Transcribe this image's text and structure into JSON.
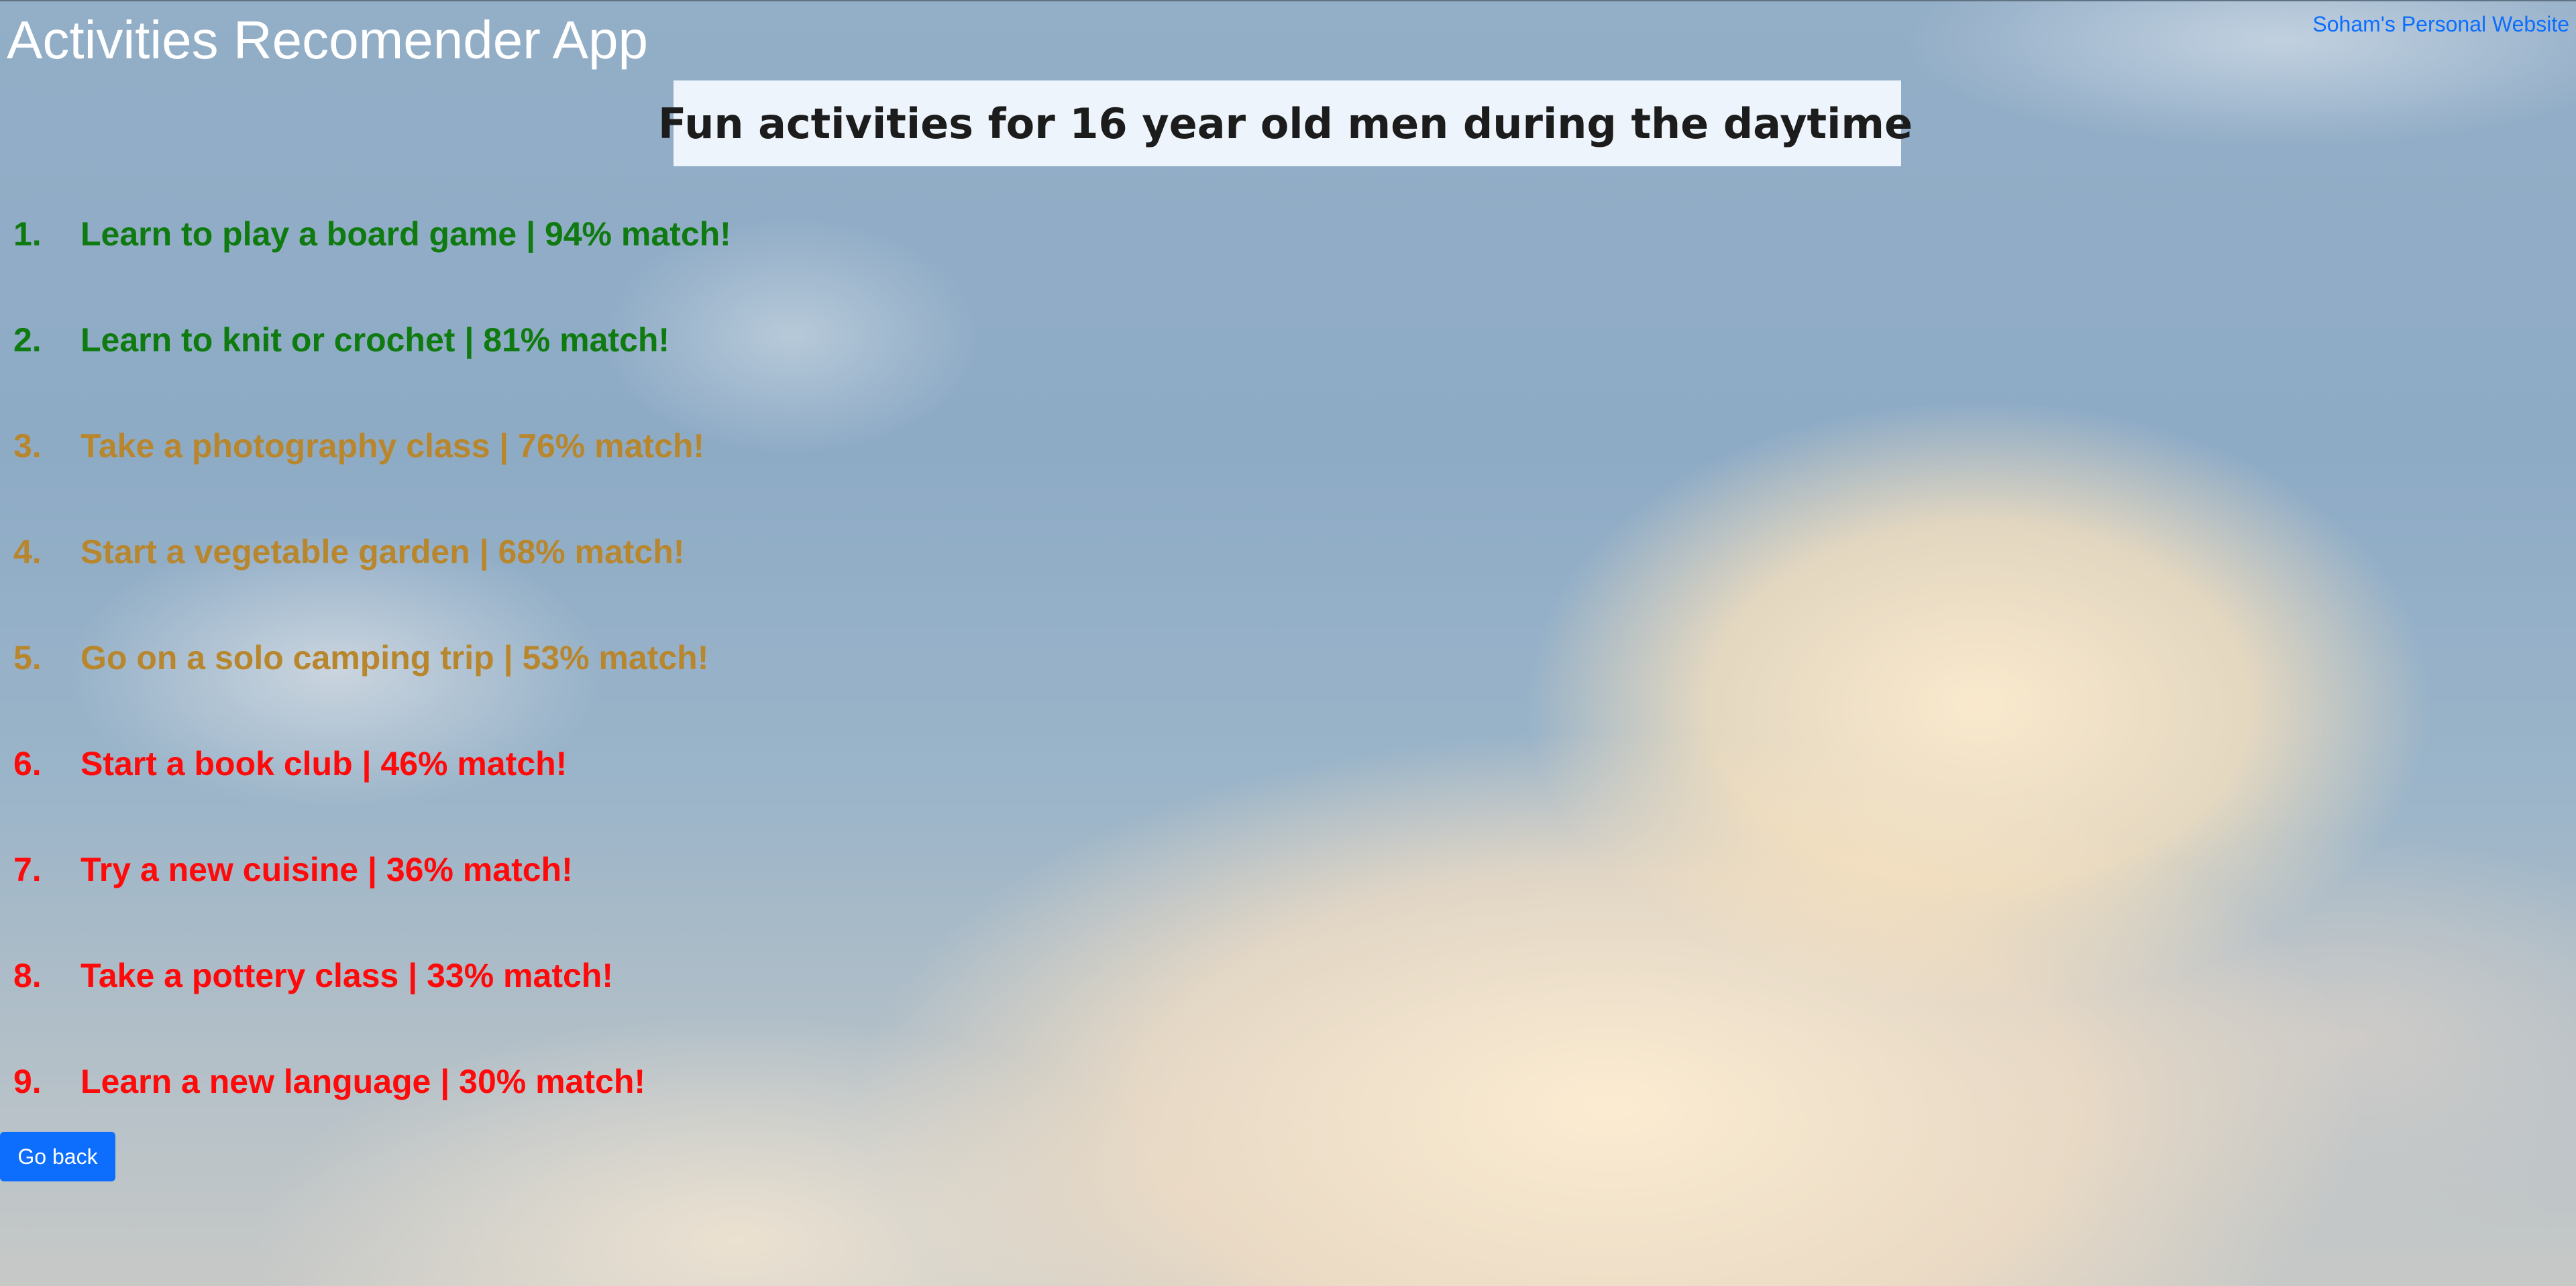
{
  "app": {
    "title": "Activities Recomender App",
    "personal_link": "Soham's Personal Website"
  },
  "headline": {
    "text": "Fun activities for 16 year old men during the daytime",
    "icon": "sun-icon"
  },
  "colors": {
    "high_match": "#0f7a0f",
    "medium_match": "#b8862d",
    "low_match": "#ff0a0a",
    "button": "#0d6efd",
    "link": "#0d6efd"
  },
  "activities": [
    {
      "number": "1.",
      "text": "Learn to play a board game | 94% match!",
      "match": 94,
      "tier": "high"
    },
    {
      "number": "2.",
      "text": "Learn to knit or crochet | 81% match!",
      "match": 81,
      "tier": "high"
    },
    {
      "number": "3.",
      "text": "Take a photography class | 76% match!",
      "match": 76,
      "tier": "medium"
    },
    {
      "number": "4.",
      "text": "Start a vegetable garden | 68% match!",
      "match": 68,
      "tier": "medium"
    },
    {
      "number": "5.",
      "text": "Go on a solo camping trip | 53% match!",
      "match": 53,
      "tier": "medium"
    },
    {
      "number": "6.",
      "text": "Start a book club | 46% match!",
      "match": 46,
      "tier": "low"
    },
    {
      "number": "7.",
      "text": "Try a new cuisine | 36% match!",
      "match": 36,
      "tier": "low"
    },
    {
      "number": "8.",
      "text": "Take a pottery class | 33% match!",
      "match": 33,
      "tier": "low"
    },
    {
      "number": "9.",
      "text": "Learn a new language | 30% match!",
      "match": 30,
      "tier": "low"
    }
  ],
  "actions": {
    "go_back_label": "Go back"
  }
}
